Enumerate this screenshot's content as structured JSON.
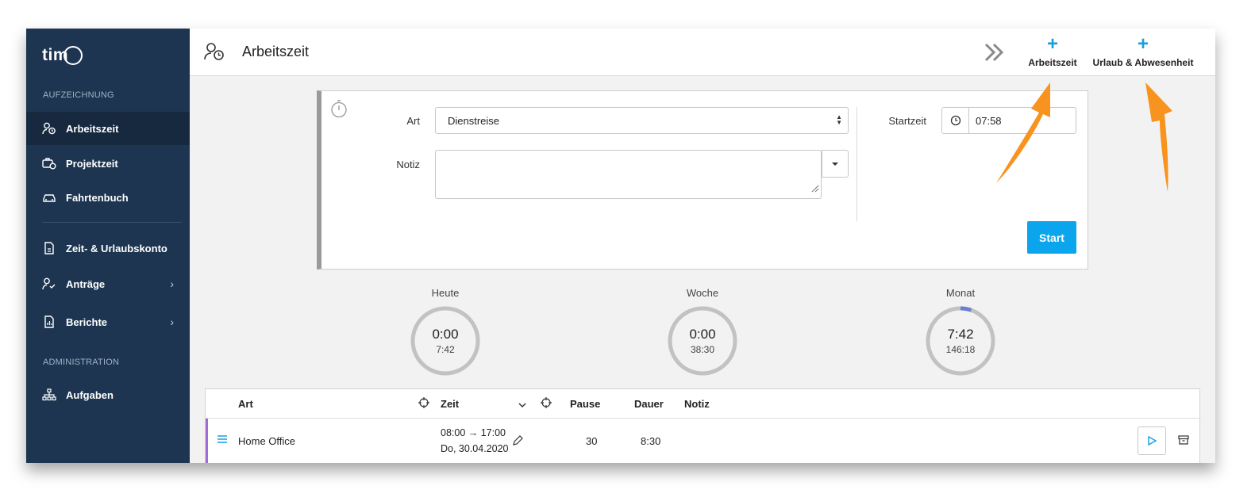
{
  "app": {
    "logo_text": "tim",
    "page_title": "Arbeitszeit"
  },
  "sidebar": {
    "section_recording": "AUFZEICHNUNG",
    "section_admin": "ADMINISTRATION",
    "items": [
      {
        "label": "Arbeitszeit",
        "icon": "user-clock-icon",
        "active": true
      },
      {
        "label": "Projektzeit",
        "icon": "briefcase-clock-icon"
      },
      {
        "label": "Fahrtenbuch",
        "icon": "car-icon"
      },
      {
        "label": "Zeit- & Urlaubskonto",
        "icon": "document-icon"
      },
      {
        "label": "Anträge",
        "icon": "user-check-icon",
        "chevron": "›"
      },
      {
        "label": "Berichte",
        "icon": "report-icon",
        "chevron": "›"
      },
      {
        "label": "Aufgaben",
        "icon": "sitemap-icon"
      }
    ]
  },
  "header": {
    "expand_icon": "double-chevron-right-icon",
    "add_worktime": {
      "plus": "+",
      "label": "Arbeitszeit"
    },
    "add_leave": {
      "plus": "+",
      "label": "Urlaub & Abwesenheit"
    }
  },
  "form": {
    "art_label": "Art",
    "art_value": "Dienstreise",
    "notiz_label": "Notiz",
    "notiz_value": "",
    "startzeit_label": "Startzeit",
    "startzeit_value": "07:58",
    "start_button": "Start"
  },
  "stats": [
    {
      "label": "Heute",
      "value": "0:00",
      "target": "7:42",
      "progress": 0.0
    },
    {
      "label": "Woche",
      "value": "0:00",
      "target": "38:30",
      "progress": 0.0
    },
    {
      "label": "Monat",
      "value": "7:42",
      "target": "146:18",
      "progress": 0.053
    }
  ],
  "table": {
    "headers": {
      "art": "Art",
      "zeit": "Zeit",
      "pause": "Pause",
      "dauer": "Dauer",
      "notiz": "Notiz"
    },
    "rows": [
      {
        "art": "Home Office",
        "zeit_range": "08:00 → 17:00",
        "zeit_date": "Do, 30.04.2020",
        "pause": "30",
        "dauer": "8:30",
        "notiz": ""
      }
    ]
  },
  "colors": {
    "sidebar": "#1d3550",
    "accent": "#0aa5ec",
    "annotation_arrow": "#f7931e",
    "row_marker": "#a26ad6"
  }
}
